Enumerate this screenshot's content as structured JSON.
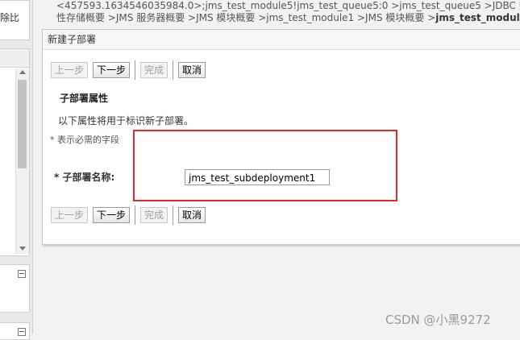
{
  "left": {
    "top_text": "除比"
  },
  "breadcrumb": {
    "line1": "<457593.1634546035984.0>;jms_test_module5!jms_test_queue5:0 >jms_test_queue5 >JDBC 数据源",
    "line2": "性存储概要 >JMS 服务器概要 >JMS 模块概要 >jms_test_module1 >JMS 模块概要 >",
    "current": "jms_test_modul"
  },
  "panel": {
    "title": "新建子部署",
    "buttons": {
      "back": "上一步",
      "next": "下一步",
      "finish": "完成",
      "cancel": "取消"
    },
    "section_title": "子部署属性",
    "description": "以下属性将用于标识新子部署。",
    "required_note": "* 表示必需的字段",
    "field_label": "* 子部署名称:",
    "field_value": "jms_test_subdeployment1"
  },
  "watermark": "CSDN @小黑9272"
}
